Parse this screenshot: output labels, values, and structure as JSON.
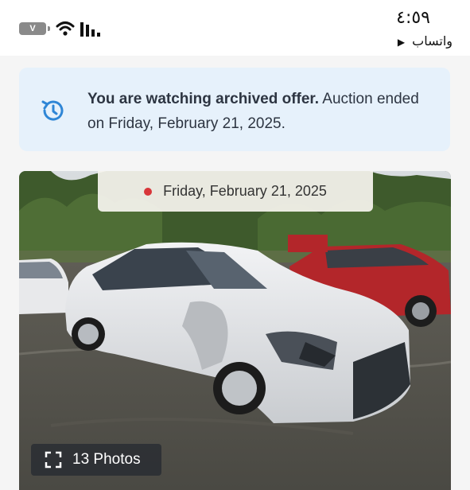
{
  "status_bar": {
    "battery_label": "V",
    "time": "٤:٥٩",
    "back_app": "واتساب",
    "back_icon": "triangle-right-icon"
  },
  "banner": {
    "icon": "history-icon",
    "bold_text": "You are watching archived offer.",
    "rest_text": " Auction ended on Friday, February 21, 2025.",
    "accent_color": "#2f86d6",
    "background": "#e6f1fb"
  },
  "photo_card": {
    "date_label": "Friday, February 21, 2025",
    "date_dot_color": "#d8363a",
    "photos_label": "13 Photos",
    "photos_icon": "expand-icon"
  }
}
